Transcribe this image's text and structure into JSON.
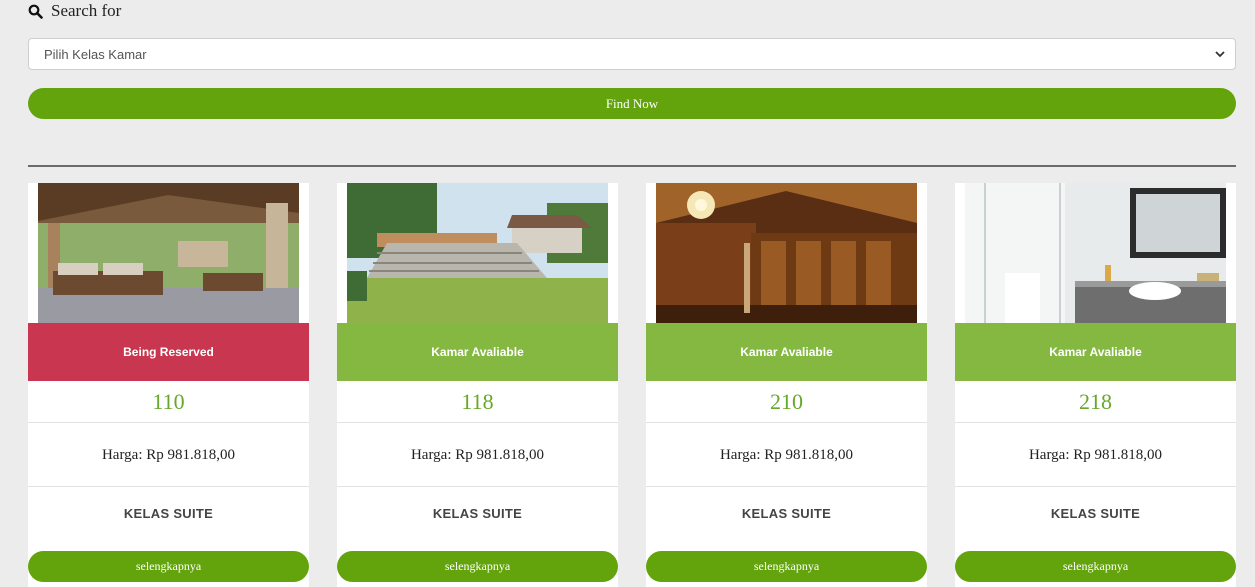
{
  "search": {
    "heading": "Search for",
    "select_value": "Pilih Kelas Kamar",
    "find_label": "Find Now"
  },
  "colors": {
    "accent_green": "#63a40c",
    "available_green": "#84b840",
    "reserved_red": "#c8374f",
    "room_number_green": "#66a82a"
  },
  "rooms": [
    {
      "status": "Being Reserved",
      "status_type": "reserved",
      "number": "110",
      "price": "Harga: Rp 981.818,00",
      "class": "KELAS SUITE",
      "button": "selengkapnya",
      "photo": "pavilion-lounge"
    },
    {
      "status": "Kamar Avaliable",
      "status_type": "available",
      "number": "118",
      "price": "Harga: Rp 981.818,00",
      "class": "KELAS SUITE",
      "button": "selengkapnya",
      "photo": "garden-amphitheater"
    },
    {
      "status": "Kamar Avaliable",
      "status_type": "available",
      "number": "210",
      "price": "Harga: Rp 981.818,00",
      "class": "KELAS SUITE",
      "button": "selengkapnya",
      "photo": "carved-wood-hall"
    },
    {
      "status": "Kamar Avaliable",
      "status_type": "available",
      "number": "218",
      "price": "Harga: Rp 981.818,00",
      "class": "KELAS SUITE",
      "button": "selengkapnya",
      "photo": "white-bathroom"
    }
  ]
}
